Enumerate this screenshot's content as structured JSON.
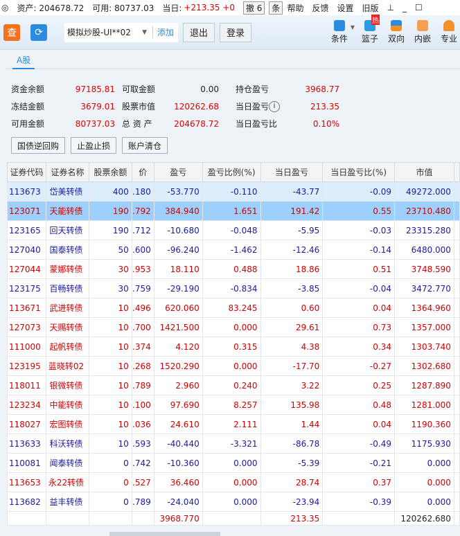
{
  "topbar": {
    "assets": "资产: 204678.72",
    "available": "可用: 80737.03",
    "today_label": "当日:",
    "today_value": "+213.35 +0",
    "cancel": "撤 6",
    "tiao": "条",
    "help": "帮助",
    "feedback": "反馈",
    "settings": "设置",
    "old": "旧版"
  },
  "toolbar": {
    "search": "查",
    "account": "模拟炒股-UI**02",
    "add": "添加",
    "logout": "退出",
    "login": "登录",
    "tools": [
      "条件",
      "篮子",
      "双向",
      "内嵌",
      "专业"
    ],
    "hot": "热"
  },
  "tab": "A股",
  "summary": {
    "cash_label": "资金余额",
    "cash": "97185.81",
    "withdraw_label": "可取金额",
    "withdraw": "0.00",
    "pos_pl_label": "持仓盈亏",
    "pos_pl": "3968.77",
    "frozen_label": "冻结金额",
    "frozen": "3679.01",
    "mv_label": "股票市值",
    "mv": "120262.68",
    "day_pl_label": "当日盈亏",
    "day_pl": "213.35",
    "avail_label": "可用金额",
    "avail": "80737.03",
    "total_label": "总 资 产",
    "total": "204678.72",
    "day_ratio_label": "当日盈亏比",
    "day_ratio": "0.10%"
  },
  "actions": [
    "国债逆回购",
    "止盈止损",
    "账户清仓"
  ],
  "columns": [
    "证券代码",
    "证券名称",
    "股票余额",
    "价",
    "盈亏",
    "盈亏比例(%)",
    "当日盈亏",
    "当日盈亏比(%)",
    "市值"
  ],
  "rows": [
    [
      "113673",
      "岱美转债",
      "400",
      ".180",
      "-53.770",
      "-0.110",
      "-43.77",
      "-0.09",
      "49272.000",
      "b"
    ],
    [
      "123071",
      "天能转债",
      "190",
      ".792",
      "384.940",
      "1.651",
      "191.42",
      "0.55",
      "23710.480",
      "r"
    ],
    [
      "123165",
      "回天转债",
      "190",
      ".712",
      "-10.680",
      "-0.048",
      "-5.95",
      "-0.03",
      "23315.280",
      "b"
    ],
    [
      "127040",
      "国泰转债",
      "50",
      ".600",
      "-96.240",
      "-1.462",
      "-12.46",
      "-0.14",
      "6480.000",
      "b"
    ],
    [
      "127044",
      "蒙娜转债",
      "30",
      ".953",
      "18.110",
      "0.488",
      "18.86",
      "0.51",
      "3748.590",
      "r"
    ],
    [
      "123175",
      "百畅转债",
      "30",
      ".759",
      "-29.190",
      "-0.834",
      "-3.85",
      "-0.04",
      "3472.770",
      "b"
    ],
    [
      "113671",
      "武进转债",
      "10",
      ".496",
      "620.060",
      "83.245",
      "0.60",
      "0.04",
      "1364.960",
      "r"
    ],
    [
      "127073",
      "天赐转债",
      "10",
      ".700",
      "1421.500",
      "0.000",
      "29.61",
      "0.73",
      "1357.000",
      "r"
    ],
    [
      "111000",
      "起帆转债",
      "10",
      ".374",
      "4.120",
      "0.315",
      "4.38",
      "0.34",
      "1303.740",
      "r"
    ],
    [
      "123195",
      "蓝晓转02",
      "10",
      ".268",
      "1520.290",
      "0.000",
      "-17.70",
      "-0.27",
      "1302.680",
      "r"
    ],
    [
      "118011",
      "银微转债",
      "10",
      ".789",
      "2.960",
      "0.240",
      "3.22",
      "0.25",
      "1287.890",
      "r"
    ],
    [
      "123234",
      "中能转债",
      "10",
      ".100",
      "97.690",
      "8.257",
      "135.98",
      "0.48",
      "1281.000",
      "r"
    ],
    [
      "118027",
      "宏图转债",
      "10",
      ".036",
      "24.610",
      "2.111",
      "1.44",
      "0.04",
      "1190.360",
      "r"
    ],
    [
      "113633",
      "科沃转债",
      "10",
      ".593",
      "-40.440",
      "-3.321",
      "-86.78",
      "-0.49",
      "1175.930",
      "b"
    ],
    [
      "110081",
      "闻泰转债",
      "0",
      ".742",
      "-10.360",
      "0.000",
      "-5.39",
      "-0.21",
      "0.000",
      "b"
    ],
    [
      "113653",
      "永22转债",
      "0",
      ".527",
      "36.460",
      "0.000",
      "28.74",
      "0.37",
      "0.000",
      "r"
    ],
    [
      "113682",
      "益丰转债",
      "0",
      ".789",
      "-24.040",
      "0.000",
      "-23.94",
      "-0.39",
      "0.000",
      "b"
    ]
  ],
  "totals": {
    "pl": "3968.770",
    "day_pl": "213.35",
    "mv": "120262.680"
  },
  "colors": {
    "red": "#d00000",
    "blue": "#1a1aa0",
    "accent": "#2b8be0"
  }
}
